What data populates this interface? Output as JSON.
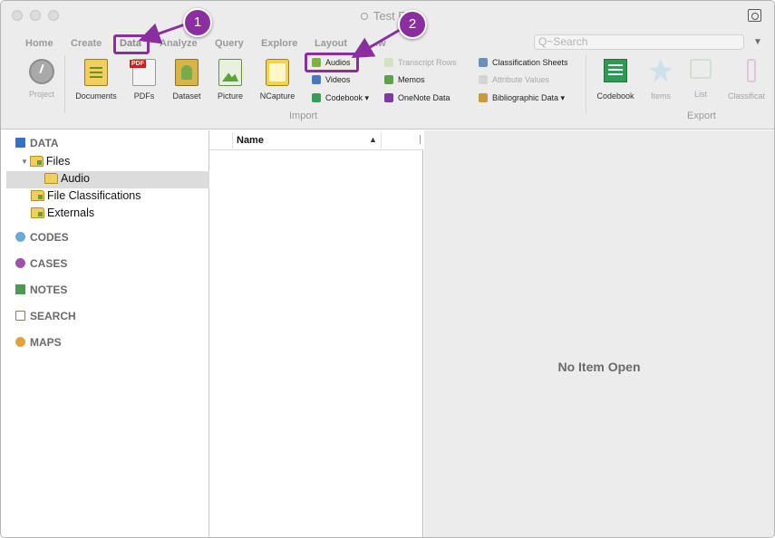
{
  "window": {
    "title": "Test P...",
    "traffic_lights": [
      "close",
      "minimize",
      "zoom"
    ]
  },
  "ribbon": {
    "tabs": [
      "Home",
      "Create",
      "Data",
      "Analyze",
      "Query",
      "Explore",
      "Layout",
      "...w"
    ],
    "active_tab": "Data",
    "search_placeholder": "Q~Search",
    "collapse_icon": "triangle-down",
    "import": {
      "label": "Import",
      "big_buttons": [
        {
          "label": "Project",
          "icon": "project-icon",
          "enabled": false
        },
        {
          "label": "Documents",
          "icon": "documents-icon",
          "enabled": true
        },
        {
          "label": "PDFs",
          "icon": "pdf-icon",
          "enabled": true
        },
        {
          "label": "Dataset",
          "icon": "dataset-icon",
          "enabled": true
        },
        {
          "label": "Picture",
          "icon": "picture-icon",
          "enabled": true
        },
        {
          "label": "NCapture",
          "icon": "ncapture-icon",
          "enabled": true
        }
      ],
      "small_buttons": [
        {
          "label": "Audios",
          "enabled": true,
          "highlighted": true
        },
        {
          "label": "Videos",
          "enabled": true
        },
        {
          "label": "Codebook ▾",
          "enabled": true
        },
        {
          "label": "Transcript Rows",
          "enabled": false
        },
        {
          "label": "Memos",
          "enabled": true
        },
        {
          "label": "OneNote Data",
          "enabled": true
        },
        {
          "label": "Classification Sheets",
          "enabled": true
        },
        {
          "label": "Attribute Values",
          "enabled": false
        },
        {
          "label": "Bibliographic Data ▾",
          "enabled": true
        }
      ]
    },
    "export": {
      "label": "Export",
      "buttons": [
        {
          "label": "Codebook",
          "enabled": true
        },
        {
          "label": "Items",
          "enabled": false
        },
        {
          "label": "List",
          "enabled": false
        },
        {
          "label": "Classificat",
          "enabled": false
        }
      ]
    }
  },
  "sidebar": {
    "sections": [
      "DATA",
      "CODES",
      "CASES",
      "NOTES",
      "SEARCH",
      "MAPS"
    ],
    "data_tree": [
      {
        "label": "Files",
        "expanded": true
      },
      {
        "label": "Audio",
        "selected": true
      },
      {
        "label": "File Classifications"
      },
      {
        "label": "Externals"
      }
    ]
  },
  "list": {
    "columns": [
      "Name"
    ]
  },
  "detail": {
    "empty_text": "No Item Open"
  },
  "annotations": {
    "step1": "1",
    "step2": "2",
    "color": "#8b2fa0"
  }
}
